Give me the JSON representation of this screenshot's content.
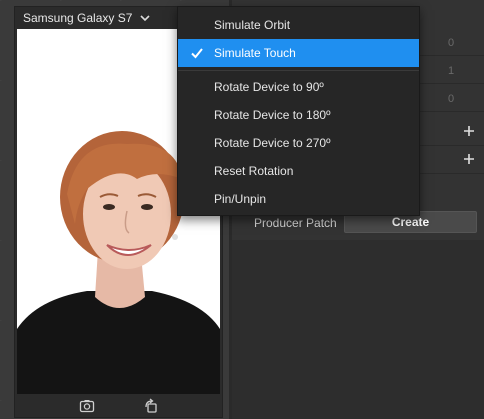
{
  "simulator": {
    "device_name": "Samsung Galaxy S7",
    "footer_icons": [
      "capture-icon",
      "rotate-icon"
    ]
  },
  "context_menu": {
    "items": [
      {
        "label": "Simulate Orbit",
        "checked": false
      },
      {
        "label": "Simulate Touch",
        "checked": true
      },
      {
        "label": "Rotate Device to 90º",
        "checked": false
      },
      {
        "label": "Rotate Device to 180º",
        "checked": false
      },
      {
        "label": "Rotate Device to 270º",
        "checked": false
      },
      {
        "label": "Reset Rotation",
        "checked": false
      },
      {
        "label": "Pin/Unpin",
        "checked": false
      }
    ]
  },
  "inspector": {
    "numeric_values": [
      "0",
      "1",
      "0"
    ],
    "producer_patch_label": "Producer Patch",
    "create_button_label": "Create"
  },
  "colors": {
    "accent": "#1f8ff0",
    "panel_bg": "#333333",
    "menu_bg": "#262626"
  }
}
